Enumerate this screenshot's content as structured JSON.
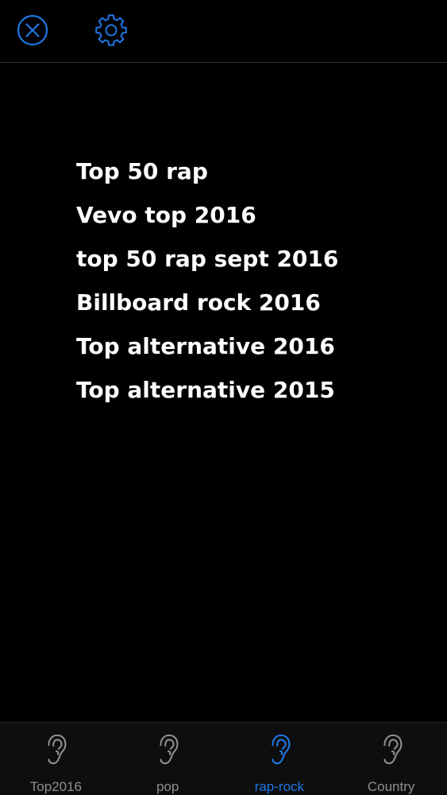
{
  "colors": {
    "accent": "#1e78e6",
    "inactive": "#8e8e93",
    "background": "#000000",
    "text": "#ffffff"
  },
  "top_bar": {
    "close_icon": "close-circle-icon",
    "settings_icon": "gear-icon"
  },
  "playlists": [
    "Top 50 rap",
    "Vevo top 2016",
    "top 50 rap sept 2016",
    "Billboard rock 2016",
    "Top alternative 2016",
    "Top alternative 2015"
  ],
  "tabs": [
    {
      "label": "Top2016",
      "icon": "ear-icon",
      "active": false
    },
    {
      "label": "pop",
      "icon": "ear-icon",
      "active": false
    },
    {
      "label": "rap-rock",
      "icon": "ear-icon",
      "active": true
    },
    {
      "label": "Country",
      "icon": "ear-icon",
      "active": false
    }
  ]
}
